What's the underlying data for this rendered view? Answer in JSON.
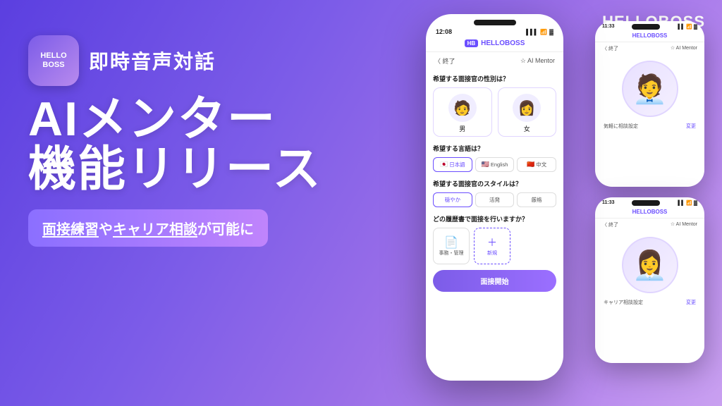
{
  "brand": {
    "name": "HELLOBOSS",
    "logo_lines": [
      "HELLO",
      "BOSS"
    ]
  },
  "hero": {
    "subtitle": "即時音声対話",
    "title_line1": "AIメンター",
    "title_line2": "機能リリース",
    "tagline": "面接練習やキャリア相談が可能に",
    "tagline_part1": "面接練習",
    "tagline_mid": "や",
    "tagline_part2": "キャリア相談",
    "tagline_end": "が可能に"
  },
  "phone_main": {
    "time": "12:08",
    "app_name": "HELLOBOSS",
    "nav_back": "〈 終了",
    "nav_mentor": "☆ AI Mentor",
    "gender_question": "希望する面接官の性別は？",
    "gender_male": "男",
    "gender_female": "女",
    "language_question": "希望する言語は？",
    "lang_japanese": "日本語",
    "lang_english": "English",
    "lang_chinese": "中文",
    "style_question": "希望する面接官のスタイルは？",
    "style_gentle": "穏やか",
    "style_active": "活発",
    "style_strict": "厳格",
    "resume_question": "どの履歴書で面接を行いますか？",
    "resume_label": "事務・管理",
    "resume_new": "新規",
    "start_button": "面接開始"
  },
  "phone_side_top": {
    "time": "11:33",
    "app_name": "HELLOBOSS",
    "nav_back": "〈 終了",
    "nav_mentor": "☆ AI Mentor",
    "setting_label": "気軽に相談設定",
    "change_label": "変更"
  },
  "phone_side_bottom": {
    "time": "11:33",
    "app_name": "HELLOBOSS",
    "nav_back": "〈 終了",
    "nav_mentor": "☆ AI Mentor",
    "setting_label": "キャリア相談設定",
    "change_label": "変更"
  }
}
